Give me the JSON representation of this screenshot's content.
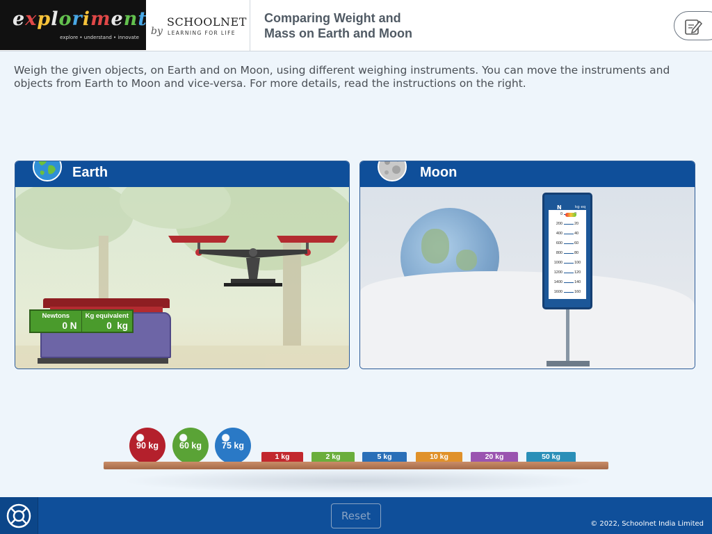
{
  "header": {
    "logo_text": "exploriments",
    "logo_tagline": "explore • understand • innovate",
    "by_text": "by",
    "partner_name": "SCHOOLNET",
    "partner_tagline": "LEARNING FOR LIFE",
    "title": "Comparing Weight and\nMass on Earth and Moon",
    "notes_icon": "notes-pencil-icon"
  },
  "instructions": "Weigh the given objects, on Earth and on Moon, using different weighing instruments. You can move the instruments and objects from Earth to Moon and vice-versa. For more details, read the instructions on the right.",
  "earth_panel": {
    "title": "Earth",
    "icon": "earth-globe-icon",
    "digital_scale": {
      "newtons_label": "Newtons",
      "newtons_value": "0 N",
      "kg_label": "Kg equivalent",
      "kg_value": "0  kg"
    }
  },
  "moon_panel": {
    "title": "Moon",
    "icon": "moon-icon",
    "spring_balance": {
      "n_label": "N",
      "kg_label": "kg eq",
      "ticks": [
        {
          "n": "0",
          "kg": "0"
        },
        {
          "n": "200",
          "kg": "20"
        },
        {
          "n": "400",
          "kg": "40"
        },
        {
          "n": "600",
          "kg": "60"
        },
        {
          "n": "800",
          "kg": "80"
        },
        {
          "n": "1000",
          "kg": "100"
        },
        {
          "n": "1200",
          "kg": "120"
        },
        {
          "n": "1400",
          "kg": "140"
        },
        {
          "n": "1600",
          "kg": "160"
        }
      ]
    }
  },
  "objects": {
    "balls": [
      {
        "label": "90 kg",
        "color": "#b4202c"
      },
      {
        "label": "60 kg",
        "color": "#5aa336"
      },
      {
        "label": "75 kg",
        "color": "#2a79c6"
      }
    ],
    "weights": [
      {
        "label": "1 kg",
        "color": "#c2282e"
      },
      {
        "label": "2 kg",
        "color": "#6aae3c"
      },
      {
        "label": "5 kg",
        "color": "#2a6fb8"
      },
      {
        "label": "10 kg",
        "color": "#e0912a"
      },
      {
        "label": "20 kg",
        "color": "#9a54b0"
      },
      {
        "label": "50 kg",
        "color": "#2a8fb8"
      }
    ]
  },
  "footer": {
    "help_icon": "lifebuoy-help-icon",
    "reset_label": "Reset",
    "copyright": "© 2022, Schoolnet India Limited"
  }
}
